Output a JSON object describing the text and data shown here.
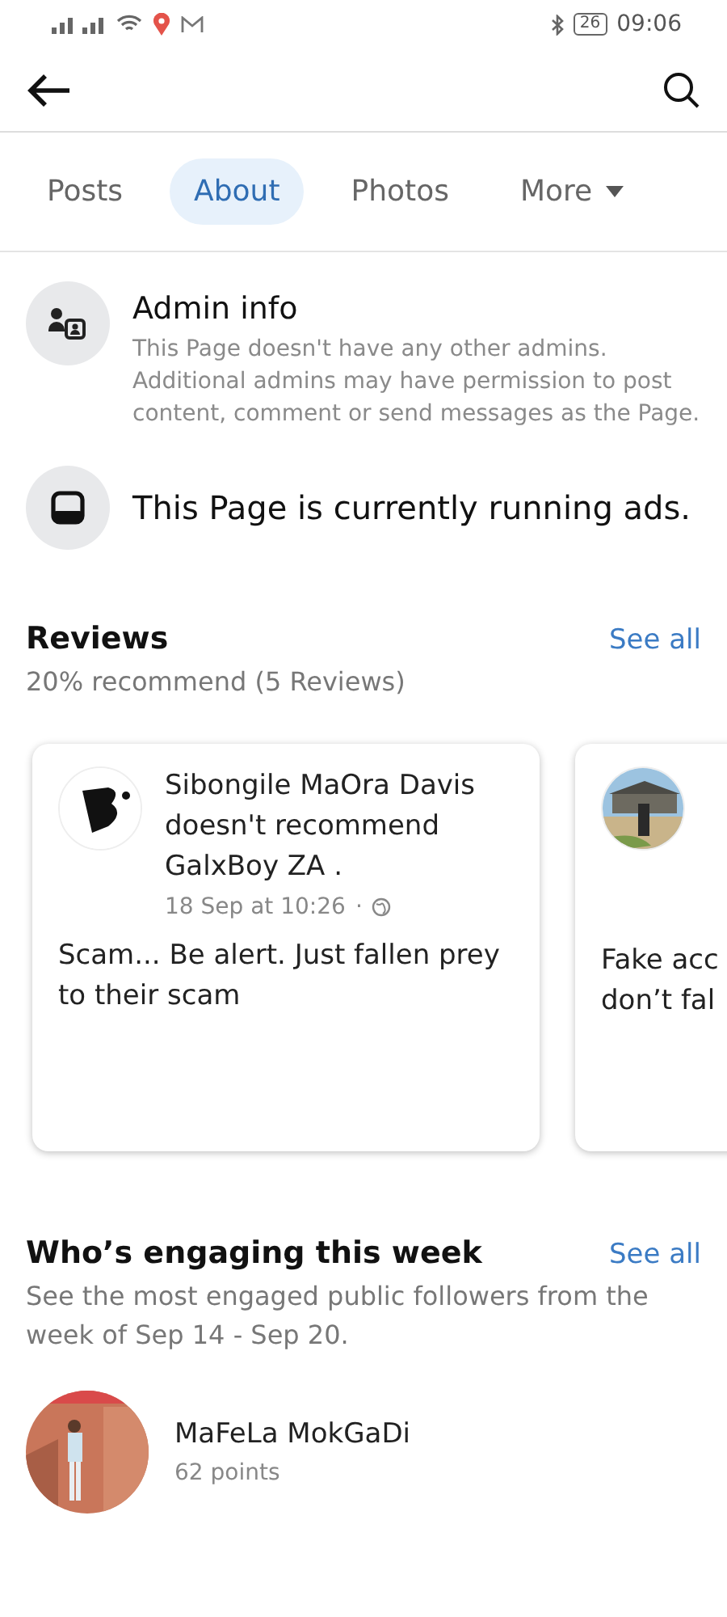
{
  "status_bar": {
    "battery": "26",
    "time": "09:06"
  },
  "tabs": [
    {
      "label": "Posts",
      "selected": false,
      "dropdown": false
    },
    {
      "label": "About",
      "selected": true,
      "dropdown": false
    },
    {
      "label": "Photos",
      "selected": false,
      "dropdown": false
    },
    {
      "label": "More",
      "selected": false,
      "dropdown": true
    }
  ],
  "info_rows": [
    {
      "kind": "admin",
      "title": "Admin info",
      "description": "This Page doesn't have any other admins. Additional admins may have permission to post content, comment or send messages as the Page."
    },
    {
      "kind": "ads",
      "title": "This Page is currently running ads."
    }
  ],
  "reviews": {
    "title": "Reviews",
    "see_all": "See all",
    "summary": "20% recommend (5 Reviews)",
    "cards": [
      {
        "kind": "logo",
        "header": "Sibongile MaOra Davis doesn't recommend GalxBoy ZA .",
        "date": "18 Sep at 10:26",
        "separator": "·",
        "public": true,
        "text": "Scam... Be alert. Just fallen prey to their scam"
      },
      {
        "text": "Fake acc\ndon’t fal"
      }
    ]
  },
  "engagement": {
    "title": "Who’s engaging this week",
    "see_all": "See all",
    "description": "See the most engaged public followers from the week of Sep 14 - Sep 20.",
    "followers": [
      {
        "name": "MaFeLa MokGaDi",
        "points": "62 points"
      }
    ]
  }
}
